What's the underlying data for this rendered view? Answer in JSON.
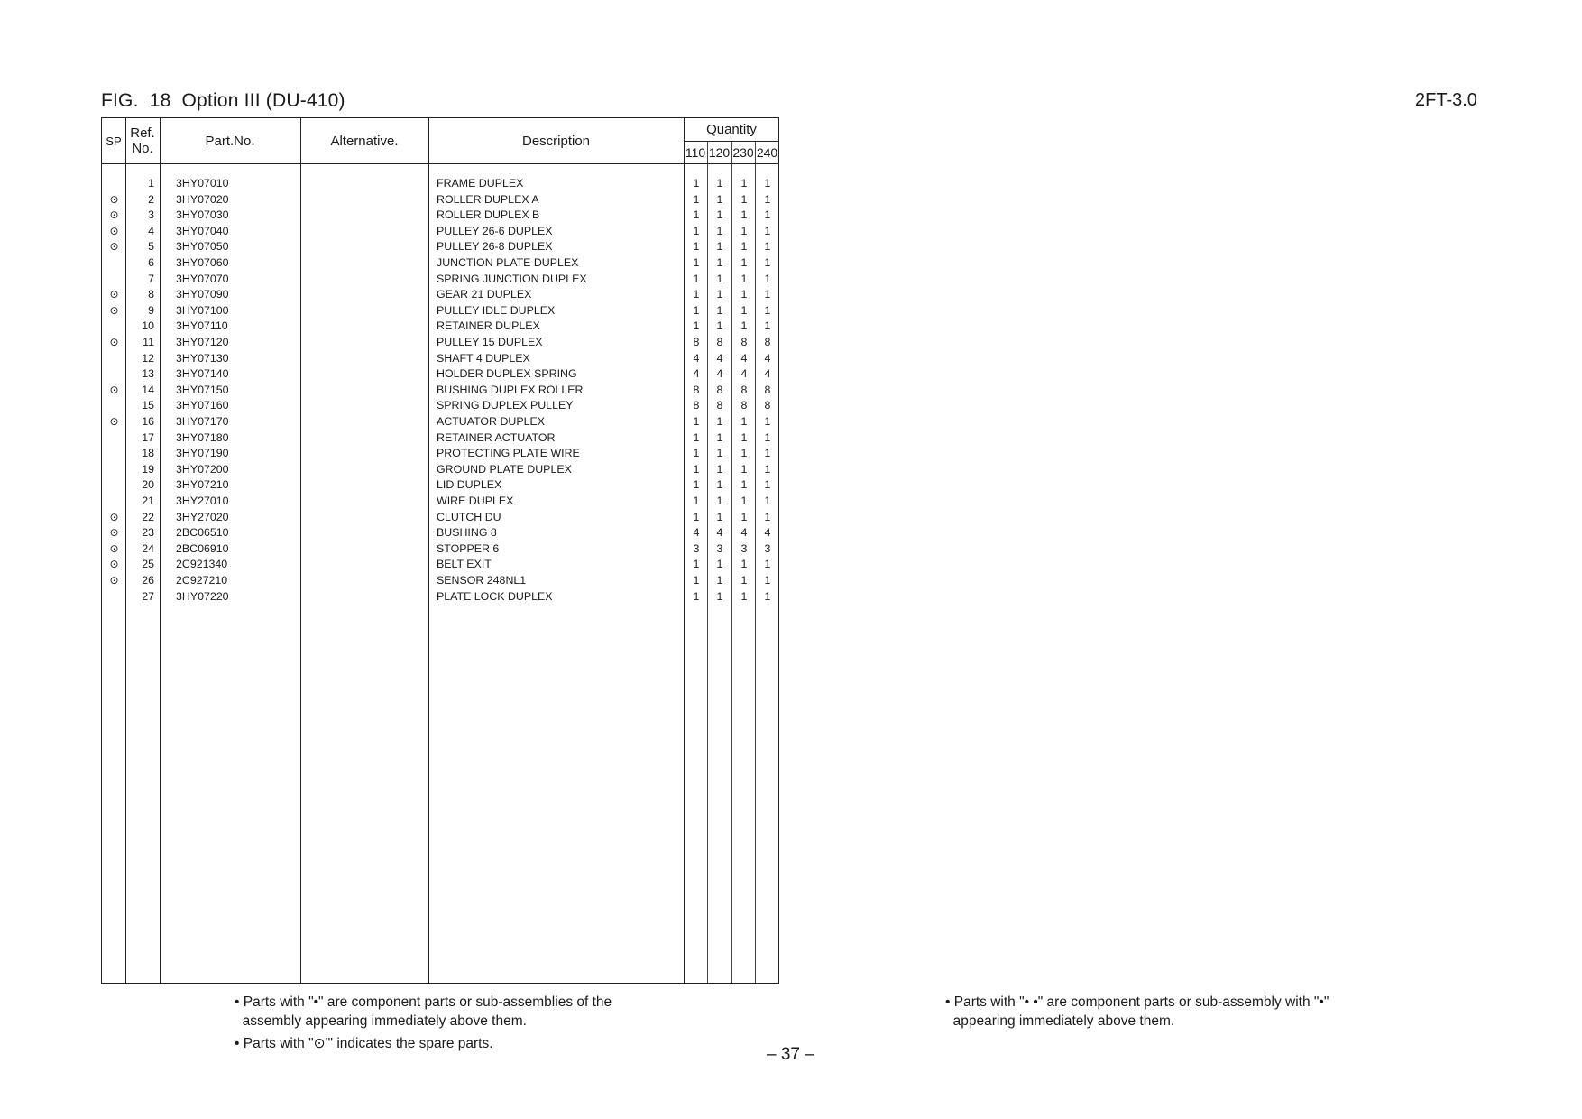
{
  "header": {
    "figure_title": "FIG.  18  Option III (DU-410)",
    "document_code": "2FT-3.0"
  },
  "table": {
    "columns": {
      "sp": "SP",
      "ref_line1": "Ref.",
      "ref_line2": "No.",
      "part_no": "Part.No.",
      "alternative": "Alternative.",
      "description": "Description",
      "quantity": "Quantity",
      "qty_variants": [
        "110",
        "120",
        "230",
        "240"
      ]
    },
    "spare_mark": "⊙",
    "rows": [
      {
        "sp": "",
        "ref": "1",
        "part": "3HY07010",
        "alt": "",
        "desc": "FRAME DUPLEX",
        "qty": [
          "1",
          "1",
          "1",
          "1"
        ]
      },
      {
        "sp": "⊙",
        "ref": "2",
        "part": "3HY07020",
        "alt": "",
        "desc": "ROLLER DUPLEX A",
        "qty": [
          "1",
          "1",
          "1",
          "1"
        ]
      },
      {
        "sp": "⊙",
        "ref": "3",
        "part": "3HY07030",
        "alt": "",
        "desc": "ROLLER DUPLEX B",
        "qty": [
          "1",
          "1",
          "1",
          "1"
        ]
      },
      {
        "sp": "⊙",
        "ref": "4",
        "part": "3HY07040",
        "alt": "",
        "desc": "PULLEY 26-6 DUPLEX",
        "qty": [
          "1",
          "1",
          "1",
          "1"
        ]
      },
      {
        "sp": "⊙",
        "ref": "5",
        "part": "3HY07050",
        "alt": "",
        "desc": "PULLEY 26-8 DUPLEX",
        "qty": [
          "1",
          "1",
          "1",
          "1"
        ]
      },
      {
        "sp": "",
        "ref": "6",
        "part": "3HY07060",
        "alt": "",
        "desc": "JUNCTION PLATE DUPLEX",
        "qty": [
          "1",
          "1",
          "1",
          "1"
        ]
      },
      {
        "sp": "",
        "ref": "7",
        "part": "3HY07070",
        "alt": "",
        "desc": "SPRING JUNCTION DUPLEX",
        "qty": [
          "1",
          "1",
          "1",
          "1"
        ]
      },
      {
        "sp": "⊙",
        "ref": "8",
        "part": "3HY07090",
        "alt": "",
        "desc": "GEAR 21 DUPLEX",
        "qty": [
          "1",
          "1",
          "1",
          "1"
        ]
      },
      {
        "sp": "⊙",
        "ref": "9",
        "part": "3HY07100",
        "alt": "",
        "desc": "PULLEY IDLE DUPLEX",
        "qty": [
          "1",
          "1",
          "1",
          "1"
        ]
      },
      {
        "sp": "",
        "ref": "10",
        "part": "3HY07110",
        "alt": "",
        "desc": "RETAINER DUPLEX",
        "qty": [
          "1",
          "1",
          "1",
          "1"
        ]
      },
      {
        "sp": "⊙",
        "ref": "11",
        "part": "3HY07120",
        "alt": "",
        "desc": "PULLEY 15 DUPLEX",
        "qty": [
          "8",
          "8",
          "8",
          "8"
        ]
      },
      {
        "sp": "",
        "ref": "12",
        "part": "3HY07130",
        "alt": "",
        "desc": "SHAFT 4 DUPLEX",
        "qty": [
          "4",
          "4",
          "4",
          "4"
        ]
      },
      {
        "sp": "",
        "ref": "13",
        "part": "3HY07140",
        "alt": "",
        "desc": "HOLDER DUPLEX SPRING",
        "qty": [
          "4",
          "4",
          "4",
          "4"
        ]
      },
      {
        "sp": "⊙",
        "ref": "14",
        "part": "3HY07150",
        "alt": "",
        "desc": "BUSHING DUPLEX ROLLER",
        "qty": [
          "8",
          "8",
          "8",
          "8"
        ]
      },
      {
        "sp": "",
        "ref": "15",
        "part": "3HY07160",
        "alt": "",
        "desc": "SPRING DUPLEX PULLEY",
        "qty": [
          "8",
          "8",
          "8",
          "8"
        ]
      },
      {
        "sp": "⊙",
        "ref": "16",
        "part": "3HY07170",
        "alt": "",
        "desc": "ACTUATOR DUPLEX",
        "qty": [
          "1",
          "1",
          "1",
          "1"
        ]
      },
      {
        "sp": "",
        "ref": "17",
        "part": "3HY07180",
        "alt": "",
        "desc": "RETAINER ACTUATOR",
        "qty": [
          "1",
          "1",
          "1",
          "1"
        ]
      },
      {
        "sp": "",
        "ref": "18",
        "part": "3HY07190",
        "alt": "",
        "desc": "PROTECTING PLATE WIRE",
        "qty": [
          "1",
          "1",
          "1",
          "1"
        ]
      },
      {
        "sp": "",
        "ref": "19",
        "part": "3HY07200",
        "alt": "",
        "desc": "GROUND PLATE DUPLEX",
        "qty": [
          "1",
          "1",
          "1",
          "1"
        ]
      },
      {
        "sp": "",
        "ref": "20",
        "part": "3HY07210",
        "alt": "",
        "desc": "LID DUPLEX",
        "qty": [
          "1",
          "1",
          "1",
          "1"
        ]
      },
      {
        "sp": "",
        "ref": "21",
        "part": "3HY27010",
        "alt": "",
        "desc": "WIRE DUPLEX",
        "qty": [
          "1",
          "1",
          "1",
          "1"
        ]
      },
      {
        "sp": "⊙",
        "ref": "22",
        "part": "3HY27020",
        "alt": "",
        "desc": "CLUTCH DU",
        "qty": [
          "1",
          "1",
          "1",
          "1"
        ]
      },
      {
        "sp": "⊙",
        "ref": "23",
        "part": "2BC06510",
        "alt": "",
        "desc": "BUSHING 8",
        "qty": [
          "4",
          "4",
          "4",
          "4"
        ]
      },
      {
        "sp": "⊙",
        "ref": "24",
        "part": "2BC06910",
        "alt": "",
        "desc": "STOPPER 6",
        "qty": [
          "3",
          "3",
          "3",
          "3"
        ]
      },
      {
        "sp": "⊙",
        "ref": "25",
        "part": "2C921340",
        "alt": "",
        "desc": "BELT EXIT",
        "qty": [
          "1",
          "1",
          "1",
          "1"
        ]
      },
      {
        "sp": "⊙",
        "ref": "26",
        "part": "2C927210",
        "alt": "",
        "desc": "SENSOR 248NL1",
        "qty": [
          "1",
          "1",
          "1",
          "1"
        ]
      },
      {
        "sp": "",
        "ref": "27",
        "part": "3HY07220",
        "alt": "",
        "desc": "PLATE LOCK DUPLEX",
        "qty": [
          "1",
          "1",
          "1",
          "1"
        ]
      }
    ]
  },
  "notes": {
    "left_note1": "• Parts with \"•\" are component parts or sub-assemblies of the\n  assembly appearing immediately above them.",
    "left_note2": "• Parts with \"⊙'\" indicates the spare parts.",
    "right_note1": "• Parts with \"• •\" are component parts or sub-assembly with \"•\"\n  appearing immediately above them."
  },
  "footer": {
    "page_number": "– 37 –"
  }
}
